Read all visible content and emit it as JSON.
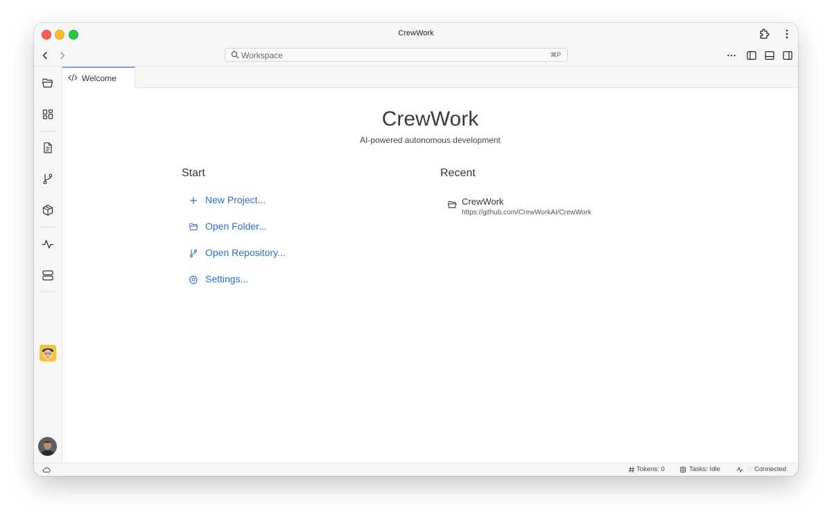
{
  "window": {
    "title": "CrewWork"
  },
  "search": {
    "placeholder": "Workspace",
    "shortcut": "⌘P"
  },
  "tabs": [
    {
      "label": "Welcome",
      "icon": "code-icon"
    }
  ],
  "welcome": {
    "title": "CrewWork",
    "subtitle": "AI-powered autonomous development",
    "start_heading": "Start",
    "start_items": [
      {
        "label": "New Project...",
        "icon": "plus-icon"
      },
      {
        "label": "Open Folder...",
        "icon": "folder-icon"
      },
      {
        "label": "Open Repository...",
        "icon": "git-branch-icon"
      },
      {
        "label": "Settings...",
        "icon": "gear-icon"
      }
    ],
    "recent_heading": "Recent",
    "recent_items": [
      {
        "name": "CrewWork",
        "url": "https://github.com/CrewWorkAI/CrewWork",
        "icon": "folder-icon"
      }
    ]
  },
  "activity_bar": [
    "folder-icon",
    "dashboard-icon",
    "document-icon",
    "git-branch-icon",
    "package-icon",
    "activity-icon",
    "server-icon",
    "mascot-avatar",
    "user-avatar"
  ],
  "status": {
    "tokens": "Tokens: 0",
    "tasks": "Tasks: Idle",
    "connection": "Connected"
  },
  "colors": {
    "accent": "#2f6ec5",
    "tab_indicator": "#7aa6e0",
    "close": "#fe5f57",
    "minimize": "#febc2e",
    "maximize": "#28c840"
  }
}
